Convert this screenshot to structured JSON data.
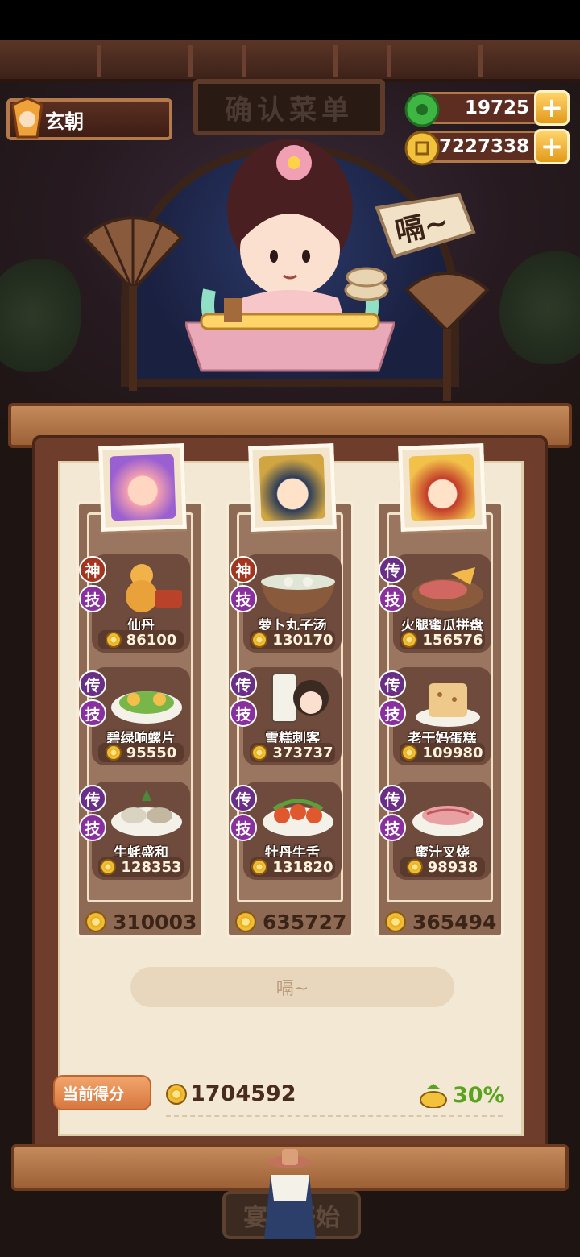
{
  "header": {
    "title": "确认菜单",
    "player_name": "玄朝",
    "jade_amount": "19725",
    "coin_amount": "77227338"
  },
  "npc": {
    "speech": "嗝~"
  },
  "columns": [
    {
      "total": "310003",
      "dishes": [
        {
          "rank": "神",
          "skill": "技",
          "name": "仙丹",
          "price": "86100"
        },
        {
          "rank": "传",
          "skill": "技",
          "name": "碧绿响螺片",
          "price": "95550"
        },
        {
          "rank": "传",
          "skill": "技",
          "name": "生蚝盛和",
          "price": "128353"
        }
      ]
    },
    {
      "total": "635727",
      "dishes": [
        {
          "rank": "神",
          "skill": "技",
          "name": "萝卜丸子汤",
          "price": "130170"
        },
        {
          "rank": "传",
          "skill": "技",
          "name": "雪糕刺客",
          "price": "373737"
        },
        {
          "rank": "传",
          "skill": "技",
          "name": "牡丹牛舌",
          "price": "131820"
        }
      ]
    },
    {
      "total": "365494",
      "dishes": [
        {
          "rank": "传",
          "skill": "技",
          "name": "火腿蜜瓜拼盘",
          "price": "156576"
        },
        {
          "rank": "传",
          "skill": "技",
          "name": "老干妈蛋糕",
          "price": "109980"
        },
        {
          "rank": "传",
          "skill": "技",
          "name": "蜜汁叉烧",
          "price": "98938"
        }
      ]
    }
  ],
  "action_button": "嗝~",
  "score": {
    "label": "当前得分",
    "value": "1704592",
    "bonus": "30%"
  },
  "start_button": "宴会开始",
  "colors": {
    "wood": "#6e3d2b",
    "paper": "#f3e8d3",
    "bonus_green": "#5aa31e"
  }
}
